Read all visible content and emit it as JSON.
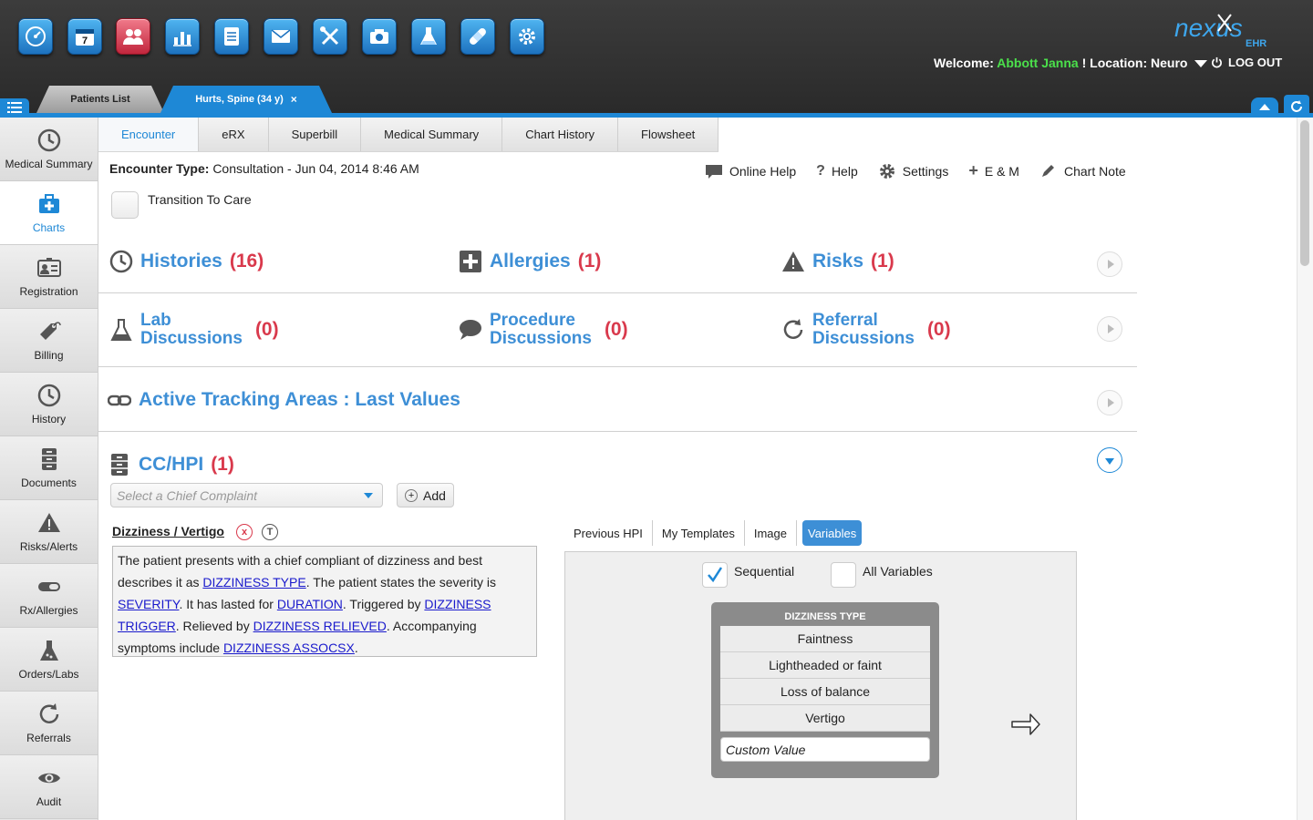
{
  "app_bar": {
    "icons": [
      "dashboard-icon",
      "calendar-icon",
      "patients-icon",
      "reports-icon",
      "tasks-icon",
      "mail-icon",
      "tools-icon",
      "scan-icon",
      "lab-icon",
      "bandage-icon",
      "settings-icon"
    ],
    "calendar_day": "7",
    "logo_text": "nexus",
    "logo_sub": "EHR",
    "welcome_prefix": "Welcome:",
    "user_name": "Abbott Janna",
    "location_text": "! Location: Neuro",
    "logout_label": "LOG OUT"
  },
  "patient_tabs": {
    "list_label": "Patients List",
    "active_label": "Hurts, Spine (34 y)",
    "close_glyph": "×"
  },
  "sidebar": {
    "items": [
      {
        "label": "Medical Summary",
        "icon": "clock-icon"
      },
      {
        "label": "Charts",
        "icon": "medkit-icon",
        "active": true
      },
      {
        "label": "Registration",
        "icon": "id-card-icon"
      },
      {
        "label": "Billing",
        "icon": "price-tag-icon"
      },
      {
        "label": "History",
        "icon": "clock-icon"
      },
      {
        "label": "Documents",
        "icon": "cabinet-icon"
      },
      {
        "label": "Risks/Alerts",
        "icon": "warning-icon"
      },
      {
        "label": "Rx/Allergies",
        "icon": "pill-icon"
      },
      {
        "label": "Orders/Labs",
        "icon": "flask-icon"
      },
      {
        "label": "Referrals",
        "icon": "refresh-icon"
      },
      {
        "label": "Audit",
        "icon": "eye-icon"
      }
    ]
  },
  "encounter_tabs": [
    "Encounter",
    "eRX",
    "Superbill",
    "Medical Summary",
    "Chart History",
    "Flowsheet"
  ],
  "encounter": {
    "type_label": "Encounter Type:",
    "type_value": "Consultation - Jun 04, 2014 8:46 AM",
    "transition_label": "Transition To Care"
  },
  "toolbar": {
    "online_help": "Online Help",
    "help": "Help",
    "settings": "Settings",
    "em": "E & M",
    "chart_note": "Chart Note"
  },
  "sections": {
    "histories": {
      "label": "Histories",
      "count": "(16)"
    },
    "allergies": {
      "label": "Allergies",
      "count": "(1)"
    },
    "risks": {
      "label": "Risks",
      "count": "(1)"
    },
    "lab": {
      "line1": "Lab",
      "line2": "Discussions",
      "count": "(0)"
    },
    "procedure": {
      "line1": "Procedure",
      "line2": "Discussions",
      "count": "(0)"
    },
    "referral": {
      "line1": "Referral",
      "line2": "Discussions",
      "count": "(0)"
    },
    "tracking": {
      "label": "Active Tracking Areas : Last Values"
    },
    "cchpi": {
      "label": "CC/HPI",
      "count": "(1)"
    }
  },
  "cc_hpi": {
    "select_placeholder": "Select a Chief Complaint",
    "add_label": "Add",
    "complaint_title": "Dizziness / Vertigo",
    "remove_glyph": "x",
    "template_glyph": "T",
    "hpi_text": {
      "t1": "The patient presents with a chief compliant of dizziness and best describes it as ",
      "l1": "DIZZINESS TYPE",
      "t2": ". The patient states the severity is ",
      "l2": "SEVERITY",
      "t3": ". It has lasted for ",
      "l3": "DURATION",
      "t4": ". Triggered by ",
      "l4": "DIZZINESS TRIGGER",
      "t5": ". Relieved by ",
      "l5": "DIZZINESS RELIEVED",
      "t6": ". Accompanying symptoms include ",
      "l6": "DIZZINESS ASSOCSX",
      "t7": "."
    }
  },
  "hpi_tabs": [
    "Previous HPI",
    "My Templates",
    "Image",
    "Variables"
  ],
  "variables": {
    "sequential_label": "Sequential",
    "sequential_checked": true,
    "all_label": "All Variables",
    "all_checked": false,
    "box_title": "DIZZINESS TYPE",
    "options": [
      "Faintness",
      "Lightheaded or faint",
      "Loss of balance",
      "Vertigo"
    ],
    "custom_value": "Custom Value"
  },
  "colors": {
    "accent": "#1e88d6",
    "section_title": "#3e8fd6",
    "count": "#d9394c",
    "user_name": "#4be04b"
  }
}
